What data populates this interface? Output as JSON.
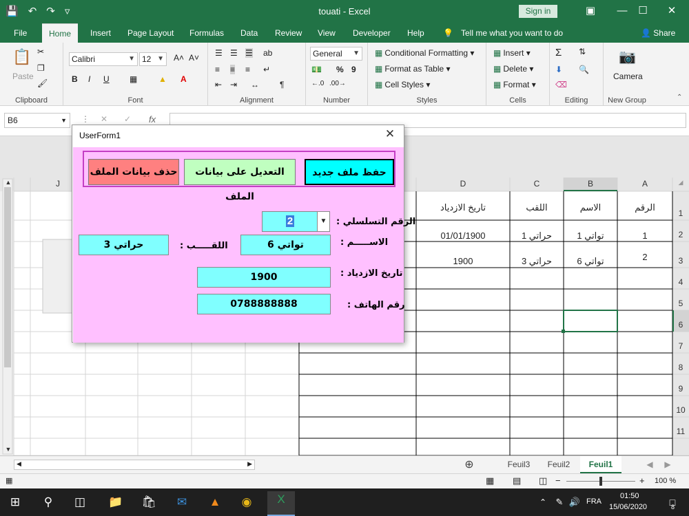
{
  "window": {
    "title": "touati - Excel",
    "signin": "Sign in"
  },
  "tabs": [
    "File",
    "Home",
    "Insert",
    "Page Layout",
    "Formulas",
    "Data",
    "Review",
    "View",
    "Developer",
    "Help"
  ],
  "tell_me": "Tell me what you want to do",
  "share": "Share",
  "ribbon": {
    "clipboard": {
      "label": "Clipboard",
      "paste": "Paste"
    },
    "font": {
      "label": "Font",
      "name": "Calibri",
      "size": "12",
      "bold": "B",
      "italic": "I",
      "underline": "U"
    },
    "alignment": {
      "label": "Alignment"
    },
    "number": {
      "label": "Number",
      "format": "General",
      "percent": "%",
      "comma": "9"
    },
    "styles": {
      "label": "Styles",
      "conditional": "Conditional Formatting",
      "table": "Format as Table",
      "cell_styles": "Cell Styles"
    },
    "cells": {
      "label": "Cells",
      "insert": "Insert",
      "delete": "Delete",
      "format": "Format"
    },
    "editing": {
      "label": "Editing"
    },
    "newgroup": {
      "label": "New Group",
      "camera": "Camera"
    }
  },
  "formula_bar": {
    "name_box": "B6",
    "fx": "fx",
    "formula": ""
  },
  "grid": {
    "columns": [
      "J",
      "D",
      "C",
      "B",
      "A"
    ],
    "rows": [
      "1",
      "2",
      "3",
      "4",
      "5",
      "6",
      "7",
      "8",
      "9",
      "10",
      "11"
    ],
    "headers": {
      "A": "الرقم",
      "B": "الاسم",
      "C": "اللقب",
      "D": "تاريخ الازدياد"
    },
    "data": [
      {
        "A": "1",
        "B": "تواتي 1",
        "C": "حراتي 1",
        "D": "01/01/1900"
      },
      {
        "A": "2",
        "B": "تواتي 6",
        "C": "حراتي 3",
        "D": "1900"
      }
    ]
  },
  "sheets": [
    "Feuil3",
    "Feuil2",
    "Feuil1"
  ],
  "status": {
    "zoom": "100 %"
  },
  "taskbar": {
    "lang": "FRA",
    "time": "01:50",
    "date": "15/06/2020",
    "notifications": "8"
  },
  "userform": {
    "title": "UserForm1",
    "buttons": {
      "save_new": "حفظ ملف جديد",
      "edit": "التعديل على بيانات الملف",
      "delete": "حذف بيانات الملف"
    },
    "labels": {
      "serial": "الرقم التسلسلي :",
      "name": "الاســـــم :",
      "surname": "اللقـــــب :",
      "birth": "تاريخ الازدياد :",
      "phone": "رقم الهاتف :"
    },
    "values": {
      "serial": "2",
      "name": "تواتي 6",
      "surname": "حراتي 3",
      "birth": "1900",
      "phone": "0788888888"
    }
  },
  "colors": {
    "excel_green": "#217346",
    "form_bg": "#ffc0ff",
    "field_bg": "#80ffff",
    "btn_save": "#00ffff",
    "btn_edit": "#c0ffc0",
    "btn_delete": "#ff8080"
  }
}
